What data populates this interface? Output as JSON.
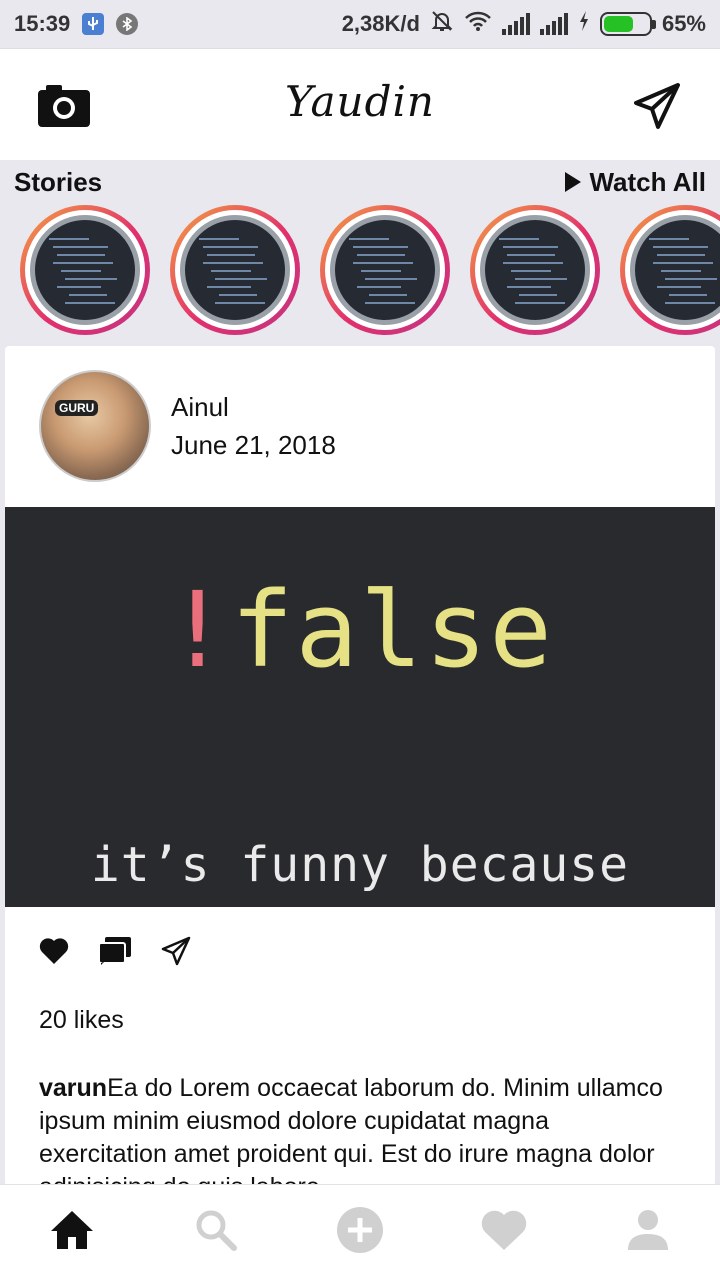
{
  "status_bar": {
    "time": "15:39",
    "speed": "2,38K/d",
    "battery_percent": "65%",
    "battery_level": 0.65,
    "icons": [
      "usb-icon",
      "notification-icon",
      "mute-icon",
      "wifi-icon",
      "signal-icon",
      "signal-icon",
      "charging-icon",
      "battery-icon"
    ]
  },
  "header": {
    "title": "Yaudin",
    "left_icon": "camera-icon",
    "right_icon": "send-icon"
  },
  "stories": {
    "title": "Stories",
    "watch_all": "Watch All",
    "count": 5
  },
  "post": {
    "user_name": "Ainul",
    "date": "June 21, 2018",
    "avatar_label": "GURU",
    "image": {
      "bang": "!",
      "headline": "false",
      "subline": "it’s funny because"
    },
    "actions": [
      "heart-icon",
      "comment-icon",
      "send-icon"
    ],
    "likes": "20 likes",
    "caption_user": "varun",
    "caption_text": "Ea do Lorem occaecat laborum do. Minim ullamco ipsum minim eiusmod dolore cupidatat magna exercitation amet proident qui. Est do irure magna dolor adipisicing do quis labore."
  },
  "bottom_nav": [
    "home-icon",
    "search-icon",
    "add-icon",
    "heart-icon",
    "profile-icon"
  ],
  "colors": {
    "accent_gradient_start": "#f4a341",
    "accent_gradient_end": "#c13584",
    "post_bg": "#292a2d",
    "code_yellow": "#e6e184",
    "code_red": "#e86f7b",
    "inactive_nav": "#d0d0d0"
  }
}
